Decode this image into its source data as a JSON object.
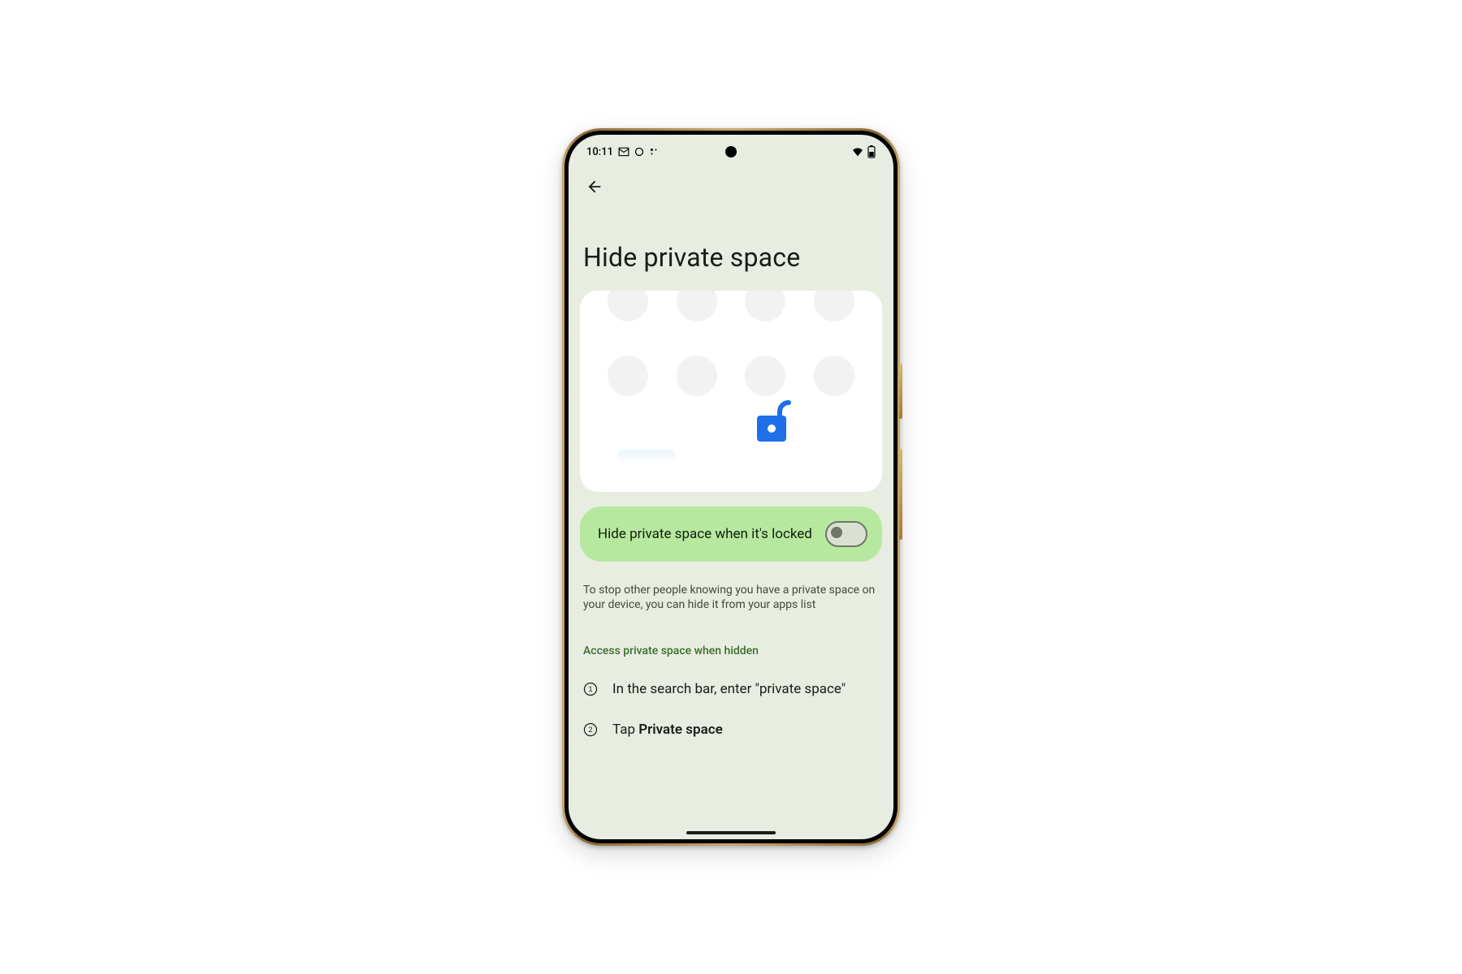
{
  "status": {
    "time": "10:11"
  },
  "page": {
    "title": "Hide private space",
    "toggle_label": "Hide private space when it's locked",
    "toggle_on": false,
    "description": "To stop other people knowing you have a private space on your device, you can hide it from your apps list",
    "section_heading": "Access private space when hidden",
    "steps": {
      "s1": "In the search bar, enter \"private space\"",
      "s2_prefix": "Tap ",
      "s2_bold": "Private space"
    }
  }
}
